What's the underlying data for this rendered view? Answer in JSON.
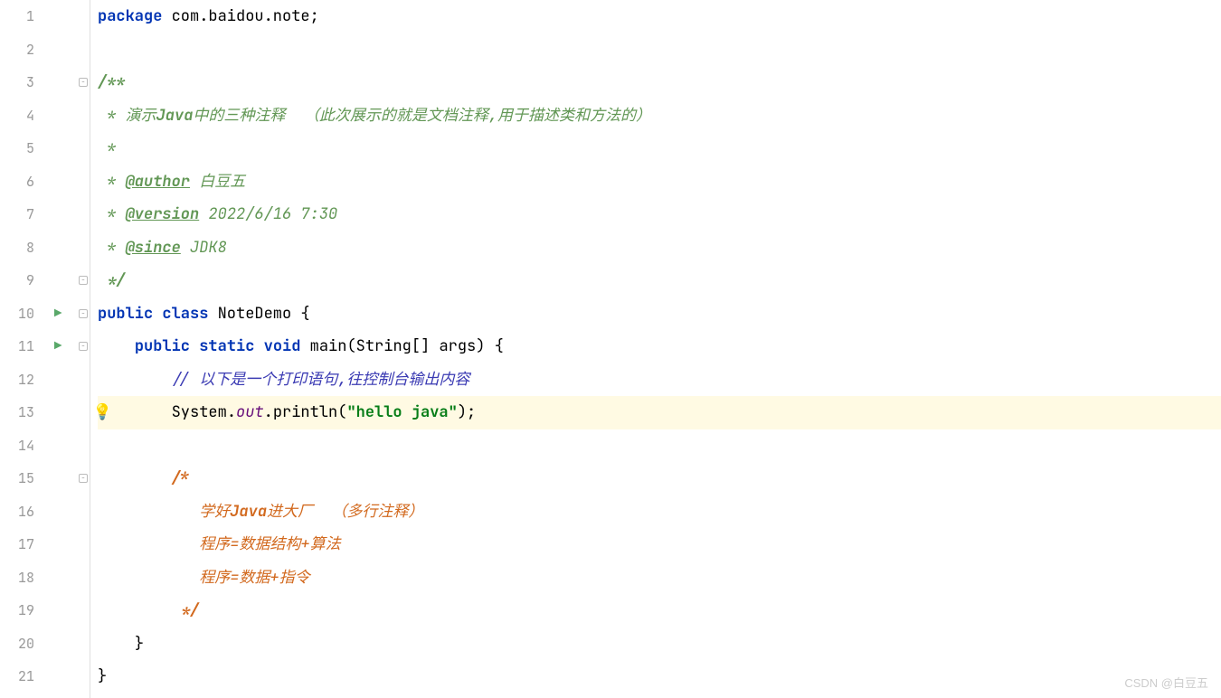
{
  "gutter": {
    "lineNumbers": [
      "1",
      "2",
      "3",
      "4",
      "5",
      "6",
      "7",
      "8",
      "9",
      "10",
      "11",
      "12",
      "13",
      "14",
      "15",
      "16",
      "17",
      "18",
      "19",
      "20",
      "21"
    ]
  },
  "code": {
    "l1_kw": "package",
    "l1_pkg": " com.baidou.note",
    "l1_semi": ";",
    "l3": "/**",
    "l4_prefix": " * 演示",
    "l4_java": "Java",
    "l4_rest": "中的三种注释  （此次展示的就是文档注释,用于描述类和方法的）",
    "l5": " *",
    "l6_star": " * ",
    "l6_tag": "@author",
    "l6_val": " 白豆五",
    "l7_star": " * ",
    "l7_tag": "@version",
    "l7_val": " 2022/6/16 7:30",
    "l8_star": " * ",
    "l8_tag": "@since",
    "l8_val": " JDK8",
    "l9": " */",
    "l10_kw1": "public",
    "l10_kw2": "class",
    "l10_name": " NoteDemo ",
    "l10_brace": "{",
    "l11_kw1": "public",
    "l11_kw2": "static",
    "l11_kw3": "void",
    "l11_method": " main",
    "l11_paren1": "(",
    "l11_type": "String",
    "l11_arr": "[] args",
    "l11_paren2": ") ",
    "l11_brace": "{",
    "l12_comment": "// 以下是一个打印语句,往控制台输出内容",
    "l13_sys": "System",
    "l13_dot1": ".",
    "l13_out": "out",
    "l13_dot2": ".",
    "l13_println": "println",
    "l13_paren1": "(",
    "l13_str": "\"hello java\"",
    "l13_paren2": ")",
    "l13_semi": ";",
    "l15": "/*",
    "l16_pre": "   学好",
    "l16_java": "Java",
    "l16_rest": "进大厂  （多行注释）",
    "l17": "   程序=数据结构+算法",
    "l18": "   程序=数据+指令",
    "l19": " */",
    "l20_brace": "}",
    "l21_brace": "}"
  },
  "watermark": "CSDN @白豆五"
}
